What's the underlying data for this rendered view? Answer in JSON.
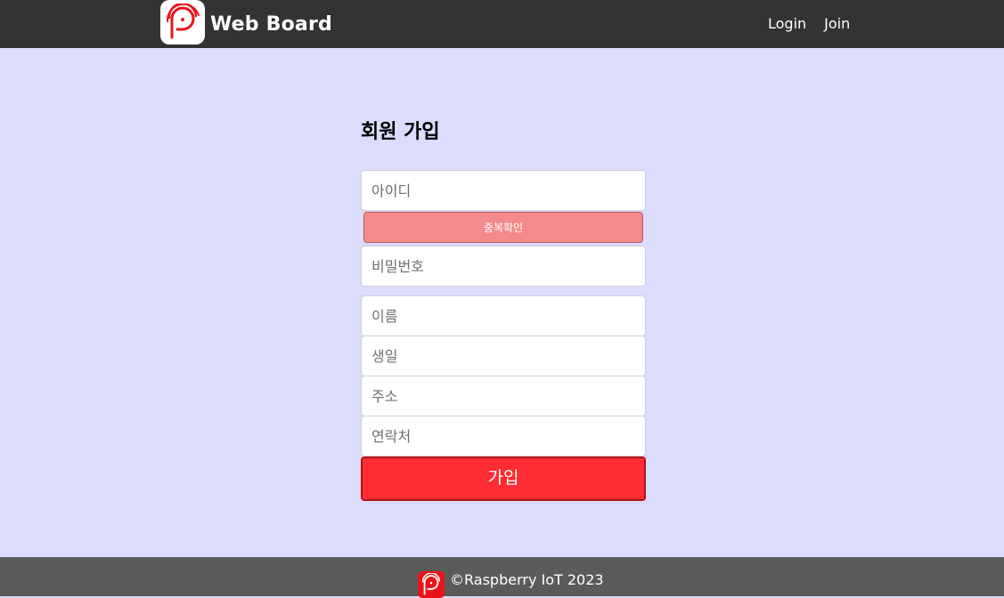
{
  "brand": {
    "title": "Web Board",
    "logo_icon": "raspberry-logo-icon",
    "accent_color": "#e8141a"
  },
  "nav": {
    "login_label": "Login",
    "join_label": "Join"
  },
  "form": {
    "heading": "회원 가입",
    "id_placeholder": "아이디",
    "duplicate_check_label": "중복확인",
    "password_placeholder": "비밀번호",
    "name_placeholder": "이름",
    "birthday_placeholder": "생일",
    "address_placeholder": "주소",
    "phone_placeholder": "연락처",
    "submit_label": "가입"
  },
  "footer": {
    "copyright": "©Raspberry IoT 2023"
  },
  "colors": {
    "navbar_bg": "#333333",
    "page_bg": "#dcdcfc",
    "submit_bg": "#ff2d33",
    "duplicate_btn_bg": "#f48a8c",
    "footer_bg": "#5b5b5b"
  }
}
